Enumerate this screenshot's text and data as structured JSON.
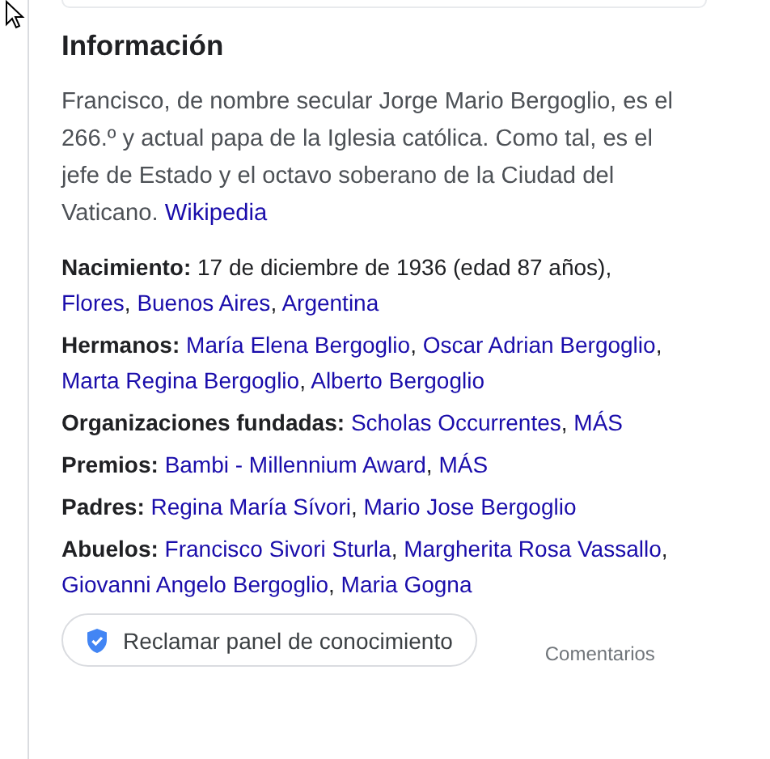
{
  "section": {
    "title": "Información"
  },
  "description": {
    "text": "Francisco, de nombre secular Jorge Mario Bergoglio, es el 266.º y actual papa de la Iglesia católica. Como tal, es el jefe de Estado y el octavo soberano de la Ciudad del Vaticano.",
    "source": "Wikipedia"
  },
  "facts": [
    {
      "label": "Nacimiento:",
      "parts": [
        {
          "kind": "text",
          "text": "17 de diciembre de 1936 (edad 87 años),"
        },
        {
          "kind": "link",
          "text": "Flores"
        },
        {
          "kind": "text",
          "text": ","
        },
        {
          "kind": "link",
          "text": "Buenos Aires"
        },
        {
          "kind": "text",
          "text": ","
        },
        {
          "kind": "link",
          "text": "Argentina"
        }
      ]
    },
    {
      "label": "Hermanos:",
      "parts": [
        {
          "kind": "link",
          "text": "María Elena Bergoglio"
        },
        {
          "kind": "text",
          "text": ","
        },
        {
          "kind": "link",
          "text": "Oscar Adrian Bergoglio"
        },
        {
          "kind": "text",
          "text": ","
        },
        {
          "kind": "link",
          "text": "Marta Regina Bergoglio"
        },
        {
          "kind": "text",
          "text": ","
        },
        {
          "kind": "link",
          "text": "Alberto Bergoglio"
        }
      ]
    },
    {
      "label": "Organizaciones fundadas:",
      "parts": [
        {
          "kind": "link",
          "text": "Scholas Occurrentes"
        },
        {
          "kind": "text",
          "text": ","
        },
        {
          "kind": "link",
          "text": "MÁS"
        }
      ]
    },
    {
      "label": "Premios:",
      "parts": [
        {
          "kind": "link",
          "text": "Bambi - Millennium Award"
        },
        {
          "kind": "text",
          "text": ","
        },
        {
          "kind": "link",
          "text": "MÁS"
        }
      ]
    },
    {
      "label": "Padres:",
      "parts": [
        {
          "kind": "link",
          "text": "Regina María Sívori"
        },
        {
          "kind": "text",
          "text": ","
        },
        {
          "kind": "link",
          "text": "Mario Jose Bergoglio"
        }
      ]
    },
    {
      "label": "Abuelos:",
      "parts": [
        {
          "kind": "link",
          "text": "Francisco Sivori Sturla"
        },
        {
          "kind": "text",
          "text": ","
        },
        {
          "kind": "link",
          "text": "Margherita Rosa Vassallo"
        },
        {
          "kind": "text",
          "text": ","
        },
        {
          "kind": "link",
          "text": "Giovanni Angelo Bergoglio"
        },
        {
          "kind": "text",
          "text": ","
        },
        {
          "kind": "link",
          "text": "Maria Gogna"
        }
      ]
    }
  ],
  "claim_button": {
    "label": "Reclamar panel de conocimiento"
  },
  "feedback": "Comentarios"
}
